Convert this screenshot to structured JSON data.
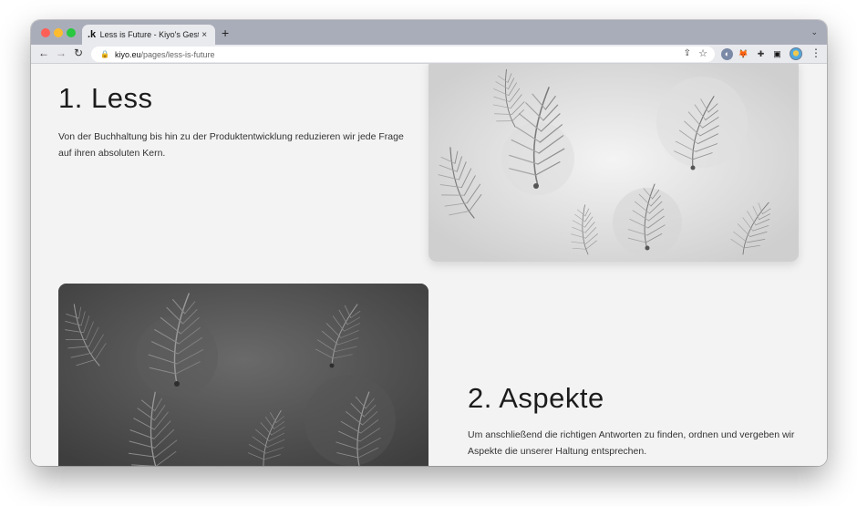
{
  "browser": {
    "tab": {
      "favicon": ".k",
      "title": "Less is Future - Kiyo's Gestaltu",
      "close": "×"
    },
    "new_tab": "+",
    "tab_menu": "⌄",
    "nav": {
      "back": "←",
      "forward": "→",
      "reload": "↻"
    },
    "url": {
      "lock": "🔒",
      "host": "kiyo.eu",
      "path": "/pages/less-is-future"
    },
    "omnibox": {
      "share": "⇪",
      "star": "☆"
    },
    "extensions": [
      "◐",
      "🦊",
      "✚",
      "▣"
    ],
    "menu": "⋮"
  },
  "page": {
    "section1": {
      "title": "1. Less",
      "text": "Von der Buchhaltung bis hin zu der Produktentwicklung reduzieren wir jede Frage auf ihren absoluten Kern."
    },
    "section2": {
      "title": "2. Aspekte",
      "text": "Um anschließend die richtigen Antworten zu finden, ordnen und vergeben wir Aspekte die unserer Haltung entsprechen."
    }
  }
}
